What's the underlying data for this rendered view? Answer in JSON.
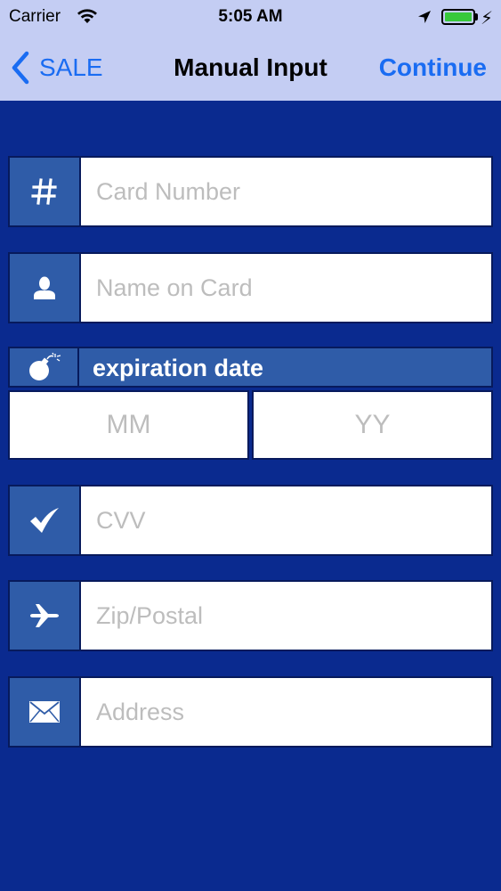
{
  "status_bar": {
    "carrier": "Carrier",
    "time": "5:05 AM",
    "icons": [
      "wifi-icon",
      "location-arrow-icon",
      "battery-icon",
      "charging-bolt-icon"
    ]
  },
  "nav": {
    "back_label": "SALE",
    "title": "Manual Input",
    "continue_label": "Continue"
  },
  "form": {
    "card_number": {
      "icon": "hash-icon",
      "placeholder": "Card Number",
      "value": ""
    },
    "name_on_card": {
      "icon": "person-icon",
      "placeholder": "Name on Card",
      "value": ""
    },
    "expiration": {
      "icon": "bomb-icon",
      "label": "expiration date",
      "month_placeholder": "MM",
      "year_placeholder": "YY"
    },
    "cvv": {
      "icon": "checkmark-icon",
      "placeholder": "CVV",
      "value": ""
    },
    "zip": {
      "icon": "airplane-icon",
      "placeholder": "Zip/Postal",
      "value": ""
    },
    "address": {
      "icon": "envelope-icon",
      "placeholder": "Address",
      "value": ""
    }
  },
  "colors": {
    "background": "#0a2a8f",
    "nav_background": "#c4cdf3",
    "icon_box": "#2f5ca8",
    "accent": "#1a6cf2",
    "placeholder": "#bdbdbd",
    "battery": "#38c93b"
  }
}
